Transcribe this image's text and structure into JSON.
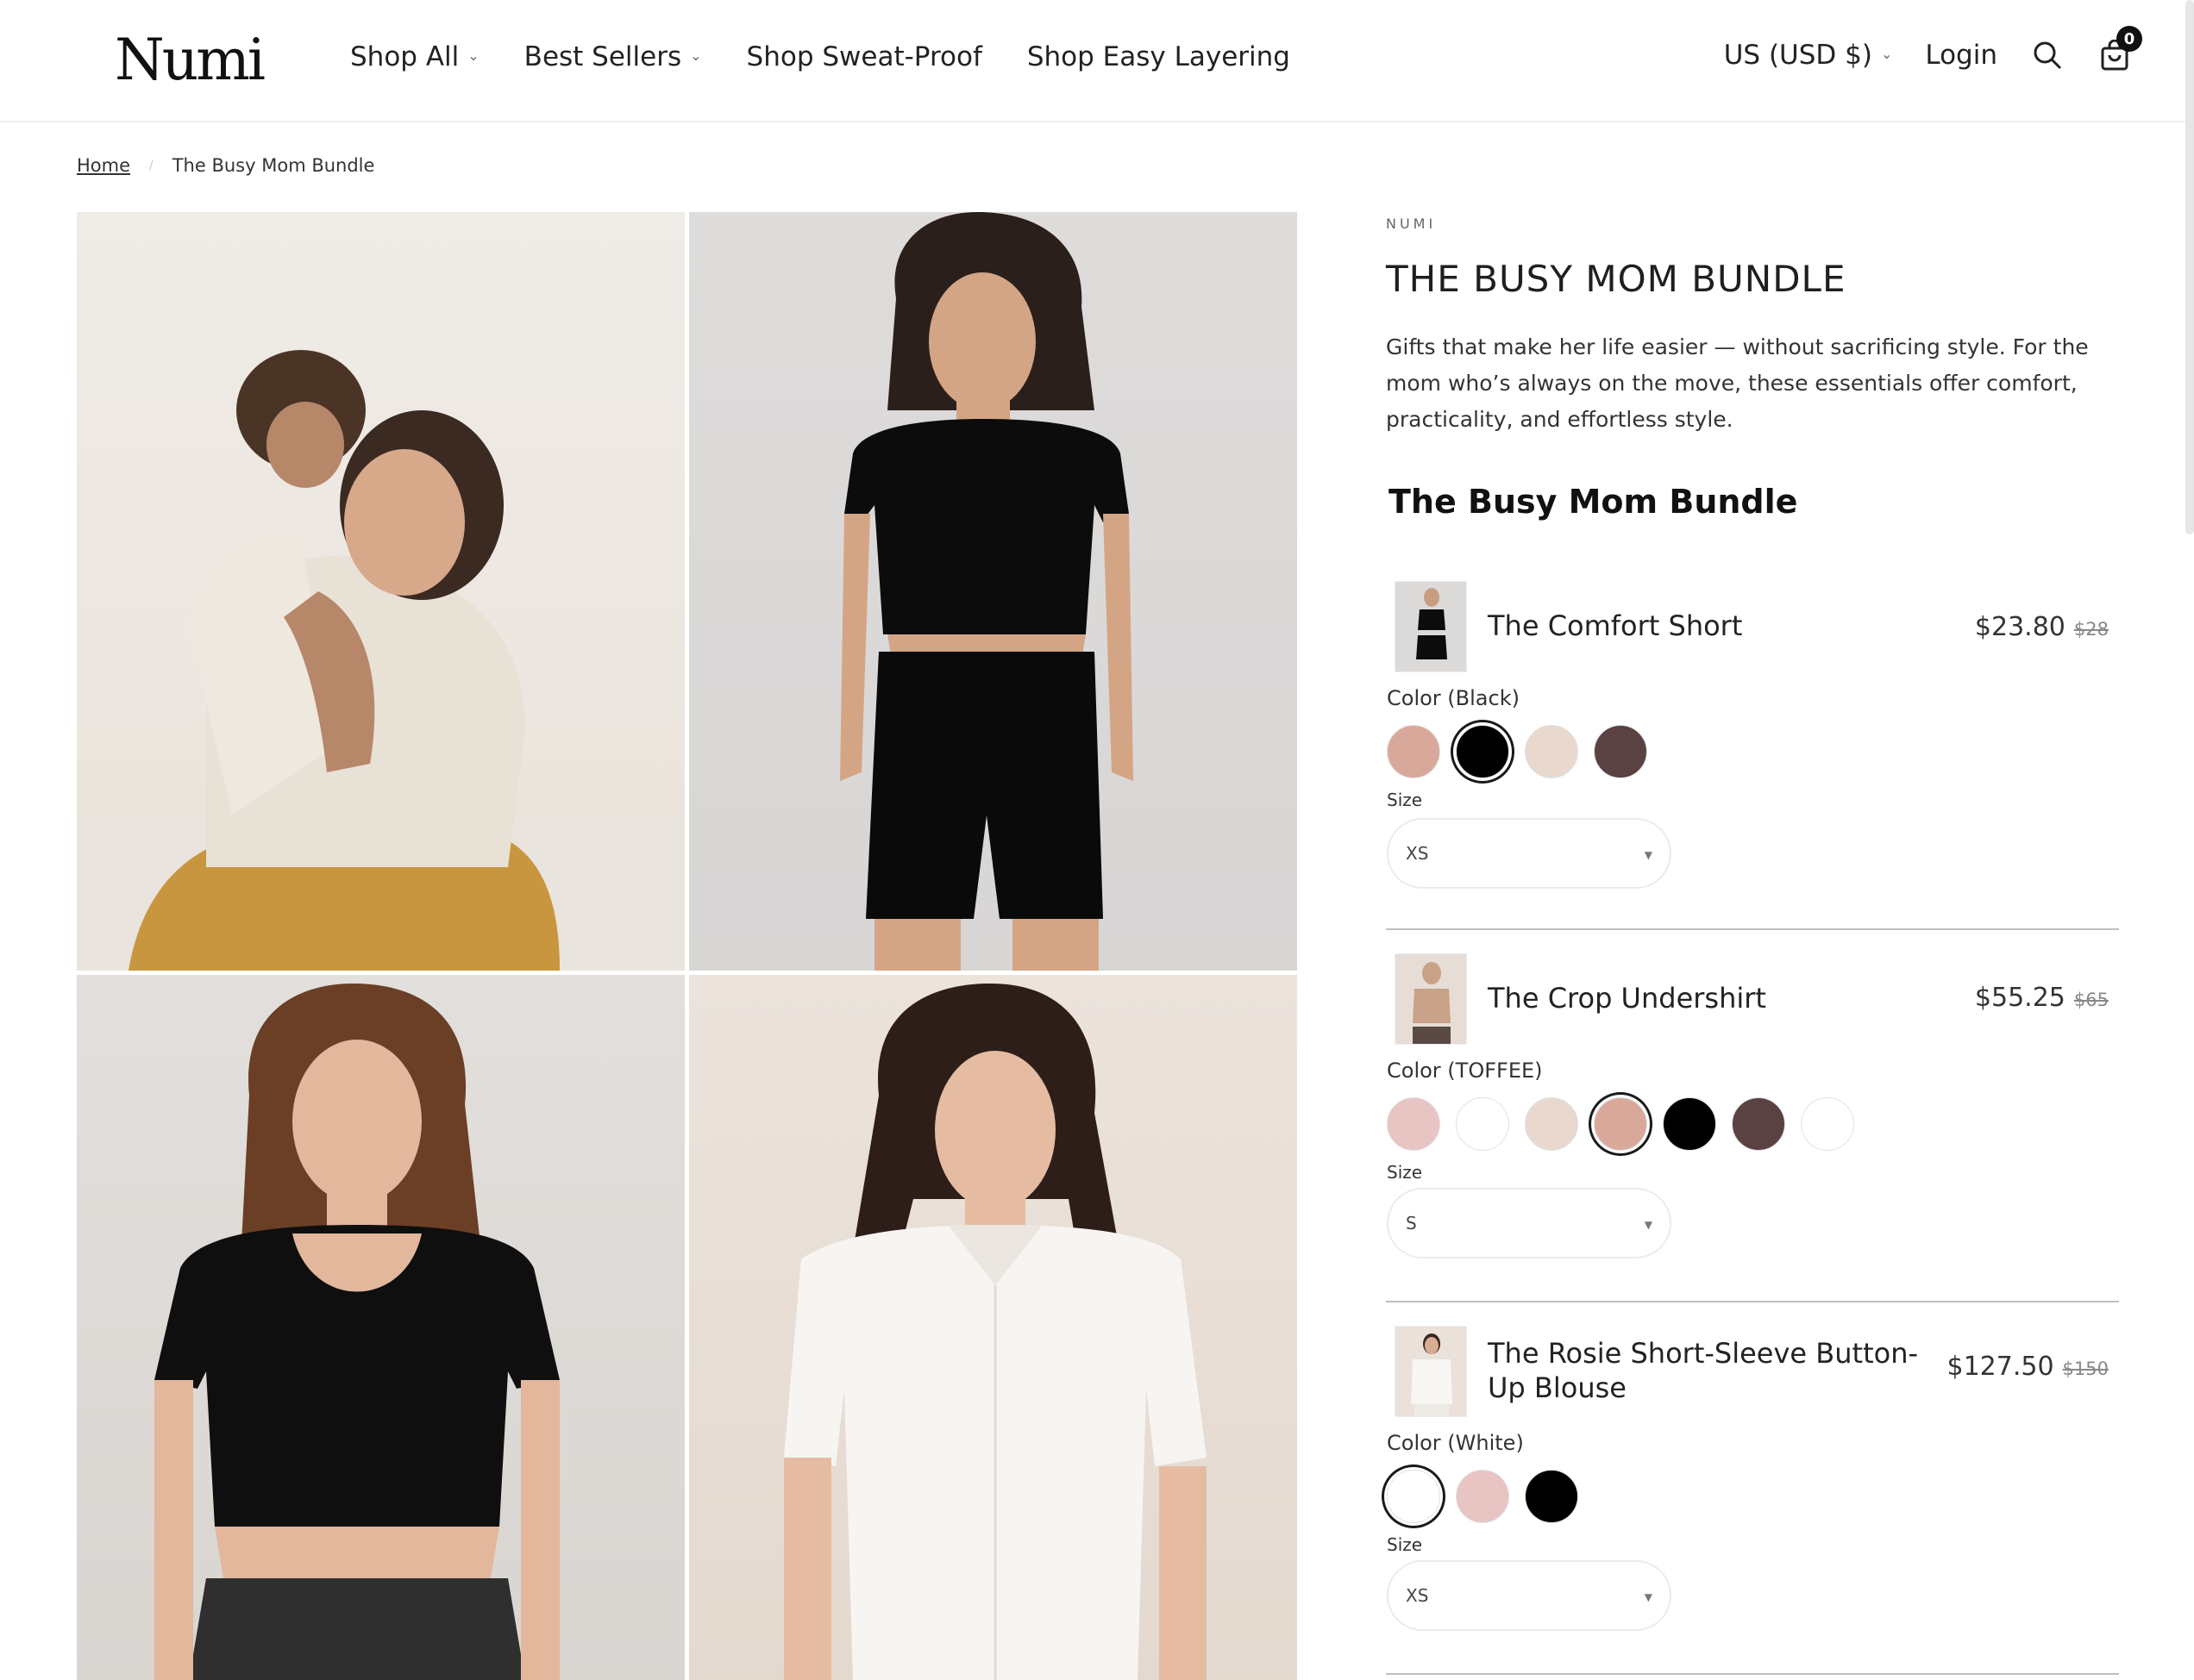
{
  "header": {
    "logo": "Numi",
    "nav": [
      {
        "label": "Shop All",
        "has_dropdown": true
      },
      {
        "label": "Best Sellers",
        "has_dropdown": true
      },
      {
        "label": "Shop Sweat-Proof",
        "has_dropdown": false
      },
      {
        "label": "Shop Easy Layering",
        "has_dropdown": false
      }
    ],
    "currency": "US (USD $)",
    "login": "Login",
    "search_icon": "search-icon",
    "cart_icon": "shopping-bag-icon",
    "cart_count": "0"
  },
  "breadcrumb": {
    "home": "Home",
    "current": "The Busy Mom Bundle"
  },
  "product": {
    "vendor": "NUMI",
    "title": "THE BUSY MOM BUNDLE",
    "description": "Gifts that make her life easier — without sacrificing style. For the mom who’s always on the move, these essentials offer comfort, practicality, and effortless style.",
    "bundle_heading": "The Busy Mom Bundle"
  },
  "bundle_items": [
    {
      "name": "The Comfort Short",
      "price": "$23.80",
      "compare_price": "$28",
      "color_label": "Color (Black)",
      "swatches": [
        "#d8a99a",
        "#000000",
        "#e8d8ce",
        "#5a4142"
      ],
      "selected_swatch": 1,
      "size_label": "Size",
      "size_value": "XS"
    },
    {
      "name": "The Crop Undershirt",
      "price": "$55.25",
      "compare_price": "$65",
      "color_label": "Color (TOFFEE)",
      "swatches": [
        "#e8c4c2",
        "#ffffff",
        "#e8d8ce",
        "#d8a99a",
        "#000000",
        "#5a4142",
        "#ffffff"
      ],
      "selected_swatch": 3,
      "size_label": "Size",
      "size_value": "S"
    },
    {
      "name": "The Rosie Short-Sleeve Button-Up Blouse",
      "price": "$127.50",
      "compare_price": "$150",
      "color_label": "Color (White)",
      "swatches": [
        "#ffffff",
        "#e8c4c2",
        "#000000"
      ],
      "selected_swatch": 0,
      "size_label": "Size",
      "size_value": "XS"
    }
  ],
  "gallery": [
    {
      "name": "mother-and-child-photo"
    },
    {
      "name": "black-crop-top-and-shorts-photo"
    },
    {
      "name": "black-crop-undershirt-photo"
    },
    {
      "name": "white-blouse-photo"
    }
  ]
}
